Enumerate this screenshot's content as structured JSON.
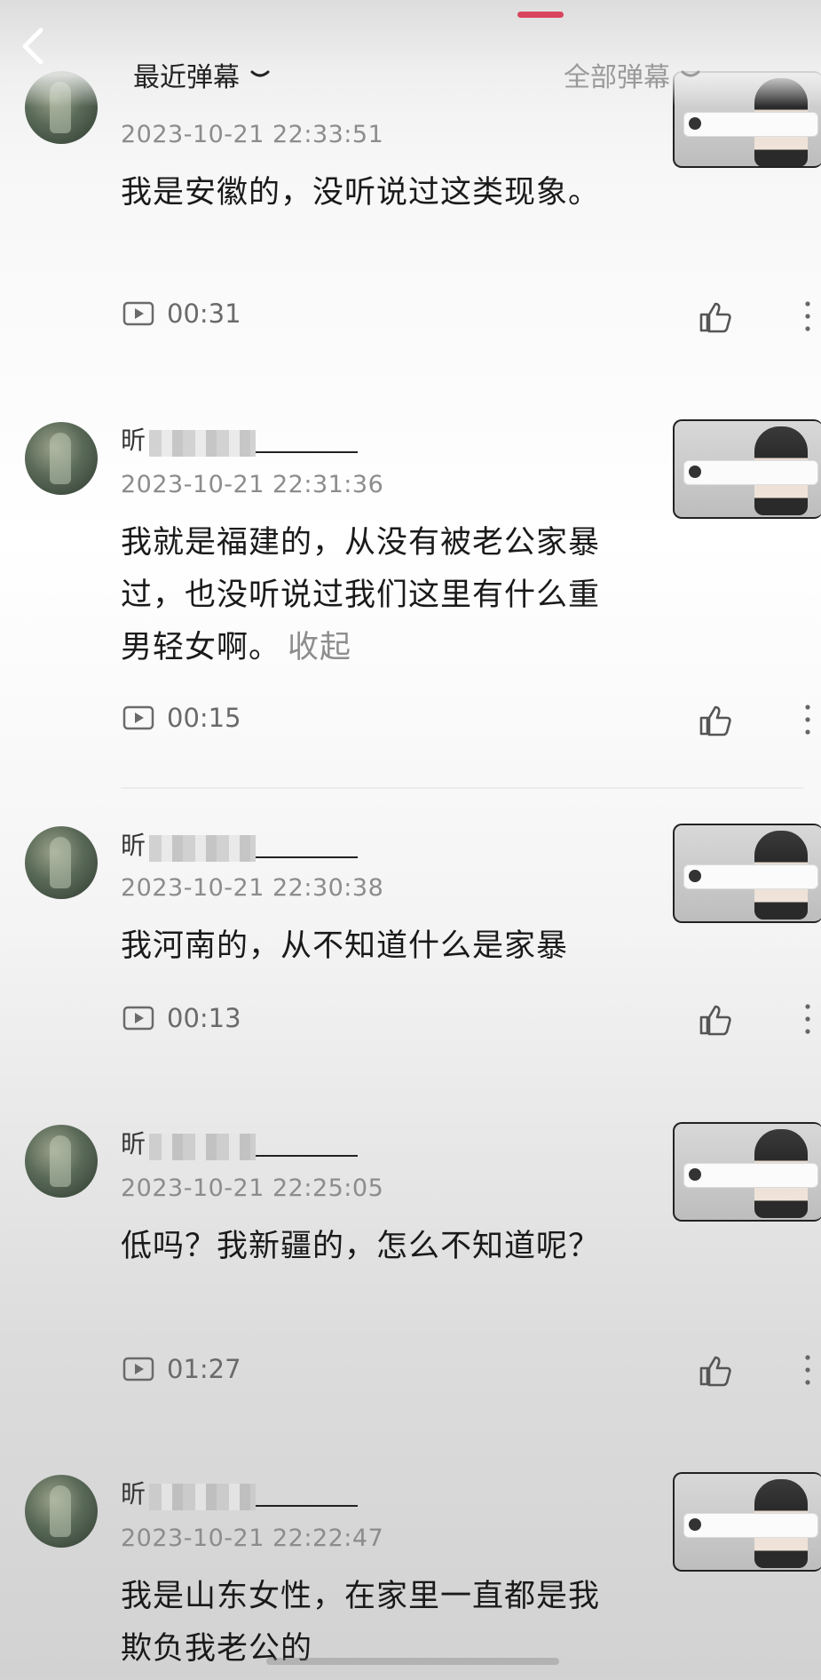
{
  "header": {
    "tabs": [
      {
        "label": "最近弹幕",
        "active": true
      },
      {
        "label": "全部弹幕",
        "active": false
      }
    ]
  },
  "colors": {
    "accent": "#d9455e",
    "muted": "#8d8d8d"
  },
  "comments": [
    {
      "username": "",
      "timestamp": "2023-10-21 22:33:51",
      "text": "我是安徽的，没听说过这类现象。",
      "play_time": "00:31",
      "action_label": ""
    },
    {
      "username": "昕",
      "timestamp": "2023-10-21 22:31:36",
      "text": "我就是福建的，从没有被老公家暴过，也没听说过我们这里有什么重男轻女啊。",
      "play_time": "00:15",
      "action_label": "收起"
    },
    {
      "username": "昕",
      "timestamp": "2023-10-21 22:30:38",
      "text": "我河南的，从不知道什么是家暴",
      "play_time": "00:13",
      "action_label": ""
    },
    {
      "username": "昕",
      "timestamp": "2023-10-21 22:25:05",
      "text": "低吗？我新疆的，怎么不知道呢？",
      "play_time": "01:27",
      "action_label": ""
    },
    {
      "username": "昕",
      "timestamp": "2023-10-21 22:22:47",
      "text": "我是山东女性，在家里一直都是我欺负我老公的",
      "play_time": "",
      "action_label": ""
    }
  ]
}
